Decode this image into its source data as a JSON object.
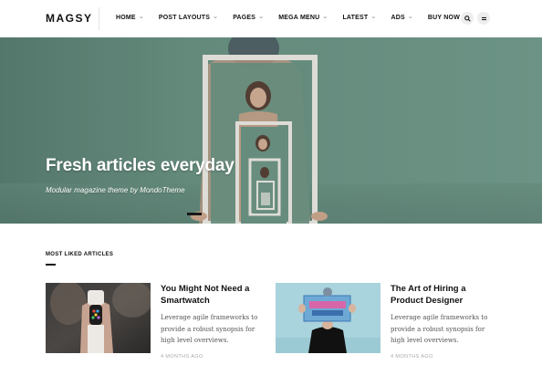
{
  "header": {
    "logo": "MAGSY",
    "nav": [
      {
        "label": "HOME",
        "dropdown": true
      },
      {
        "label": "POST LAYOUTS",
        "dropdown": true
      },
      {
        "label": "PAGES",
        "dropdown": true
      },
      {
        "label": "MEGA MENU",
        "dropdown": true
      },
      {
        "label": "LATEST",
        "dropdown": true
      },
      {
        "label": "ADS",
        "dropdown": true
      },
      {
        "label": "BUY NOW",
        "dropdown": false
      }
    ],
    "icons": [
      "search-icon",
      "menu-icon"
    ]
  },
  "hero": {
    "title": "Fresh articles everyday",
    "subtitle": "Modular magazine theme by MondoTheme"
  },
  "section": {
    "title": "MOST LIKED ARTICLES"
  },
  "articles": [
    {
      "title_line1": "You Might Not Need a",
      "title_line2": "Smartwatch",
      "excerpt_line1": "Leverage agile frameworks to",
      "excerpt_line2": "provide a robust synopsis for",
      "excerpt_line3": "high level overviews.",
      "meta": "4 MONTHS AGO"
    },
    {
      "title_line1": "The Art of Hiring a",
      "title_line2": "Product Designer",
      "excerpt_line1": "Leverage agile frameworks to",
      "excerpt_line2": "provide a robust synopsis for",
      "excerpt_line3": "high level overviews.",
      "meta": "4 MONTHS AGO"
    }
  ],
  "colors": {
    "accent": "#111111",
    "hero_bg": "#6e988a",
    "muted": "#aaaaaa"
  }
}
